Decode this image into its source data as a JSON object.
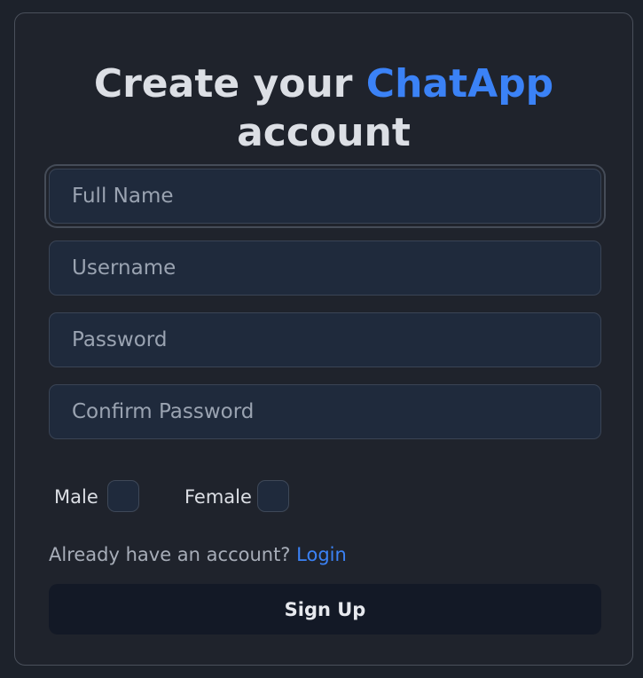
{
  "title": {
    "prefix": "Create your",
    "brand": "ChatApp",
    "suffix": "account"
  },
  "fields": {
    "full_name": {
      "placeholder": "Full Name",
      "value": ""
    },
    "username": {
      "placeholder": "Username",
      "value": ""
    },
    "password": {
      "placeholder": "Password",
      "value": ""
    },
    "confirm_password": {
      "placeholder": "Confirm Password",
      "value": ""
    }
  },
  "gender": {
    "male_label": "Male",
    "female_label": "Female"
  },
  "login": {
    "prompt": "Already have an account?",
    "link": "Login"
  },
  "submit_label": "Sign Up",
  "colors": {
    "accent": "#3b82f6",
    "background": "#1d222b",
    "card": "#1f232c",
    "input": "#1f2a3c",
    "button": "#131926"
  }
}
